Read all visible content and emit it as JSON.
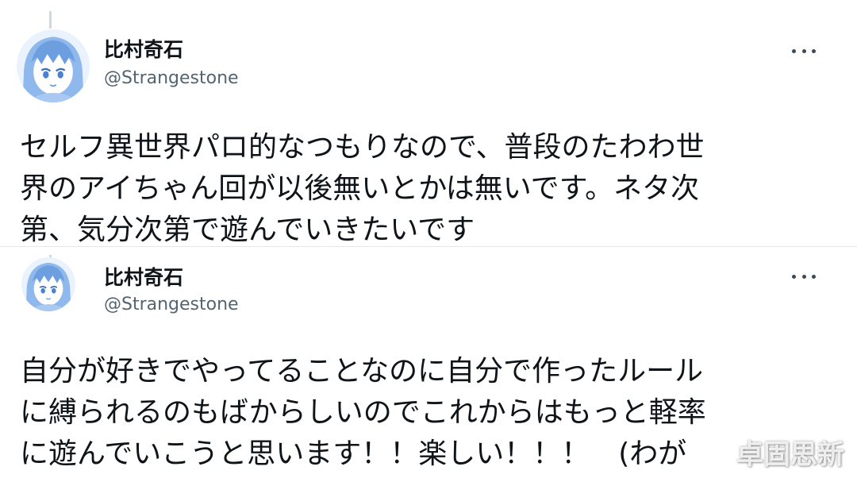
{
  "tweets": [
    {
      "author": {
        "name": "比村奇石",
        "handle": "@Strangestone"
      },
      "text": "セルフ異世界パロ的なつもりなので、普段のたわわ世\n界のアイちゃん回が以後無いとかは無いです。ネタ次\n第、気分次第で遊んでいきたいです",
      "menu_icon": "more-horizontal-icon"
    },
    {
      "author": {
        "name": "比村奇石",
        "handle": "@Strangestone"
      },
      "text": "自分が好きでやってることなのに自分で作ったルール\nに縛られるのもばからしいのでこれからはもっと軽率\nに遊んでいこうと思います！！楽しい！！！　(わが",
      "menu_icon": "more-horizontal-icon"
    }
  ],
  "watermark": "卓固思新",
  "colors": {
    "text": "#0f1419",
    "handle": "#536471",
    "avatar_tint": "#8fb8ec",
    "thread_line": "#cfd9de"
  }
}
